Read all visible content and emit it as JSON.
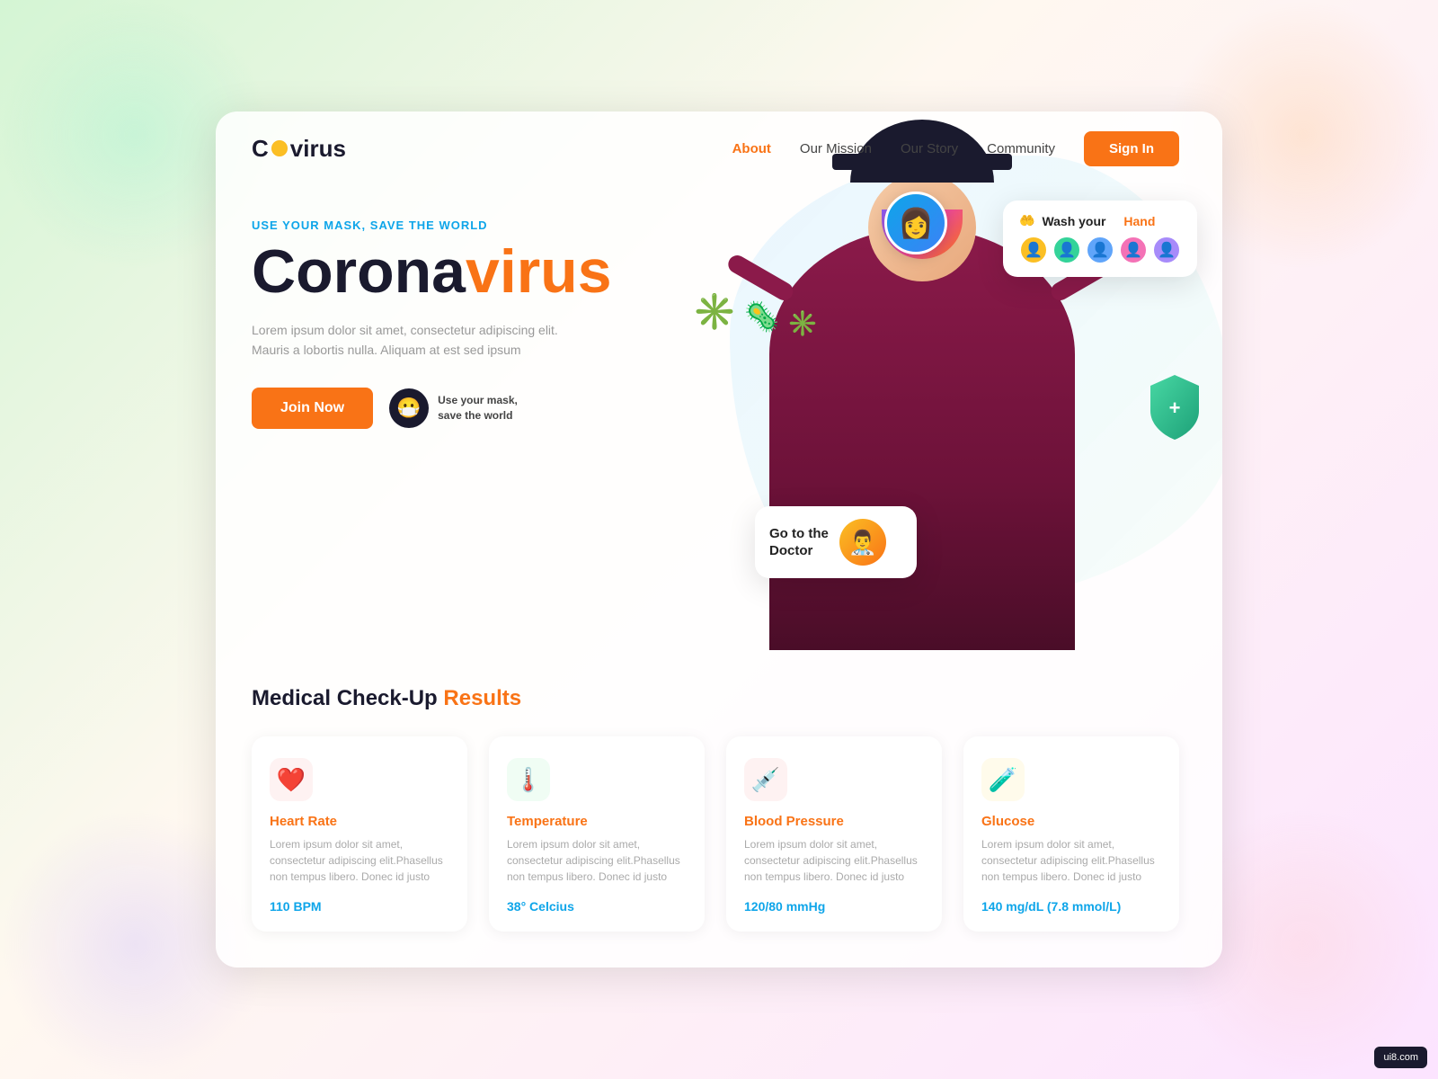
{
  "brand": {
    "name_prefix": "C",
    "name_suffix": "virus"
  },
  "navbar": {
    "links": [
      {
        "label": "About",
        "active": true
      },
      {
        "label": "Our Mission",
        "active": false
      },
      {
        "label": "Our Story",
        "active": false
      },
      {
        "label": "Community",
        "active": false
      }
    ],
    "signin_label": "Sign In"
  },
  "hero": {
    "tagline": "USE YOUR MASK, SAVE THE WORLD",
    "title_dark": "Corona",
    "title_orange": "virus",
    "description": "Lorem ipsum dolor sit amet, consectetur adipiscing elit. Mauris a lobortis nulla. Aliquam at est sed ipsum",
    "join_button": "Join Now",
    "mask_text_line1": "Use your mask,",
    "mask_text_line2": "save the world",
    "wash_hand_label": "Wash your",
    "wash_hand_colored": "Hand",
    "go_to_doctor_line1": "Go to the",
    "go_to_doctor_line2": "Doctor"
  },
  "results": {
    "title_dark": "Medical Check-Up",
    "title_orange": "Results",
    "cards": [
      {
        "icon": "❤️",
        "icon_class": "icon-heart",
        "name": "Heart Rate",
        "description": "Lorem ipsum dolor sit amet, consectetur adipiscing elit.Phasellus non tempus libero. Donec id justo",
        "value": "110 BPM"
      },
      {
        "icon": "🌡️",
        "icon_class": "icon-temp",
        "name": "Temperature",
        "description": "Lorem ipsum dolor sit amet, consectetur adipiscing elit.Phasellus non tempus libero. Donec id justo",
        "value": "38° Celcius"
      },
      {
        "icon": "💉",
        "icon_class": "icon-pressure",
        "name": "Blood Pressure",
        "description": "Lorem ipsum dolor sit amet, consectetur adipiscing elit.Phasellus non tempus libero. Donec id justo",
        "value": "120/80 mmHg"
      },
      {
        "icon": "🧪",
        "icon_class": "icon-glucose",
        "name": "Glucose",
        "description": "Lorem ipsum dolor sit amet, consectetur adipiscing elit.Phasellus non tempus libero. Donec id justo",
        "value": "140 mg/dL (7.8 mmol/L)"
      }
    ]
  },
  "watermark": "ui8.com"
}
